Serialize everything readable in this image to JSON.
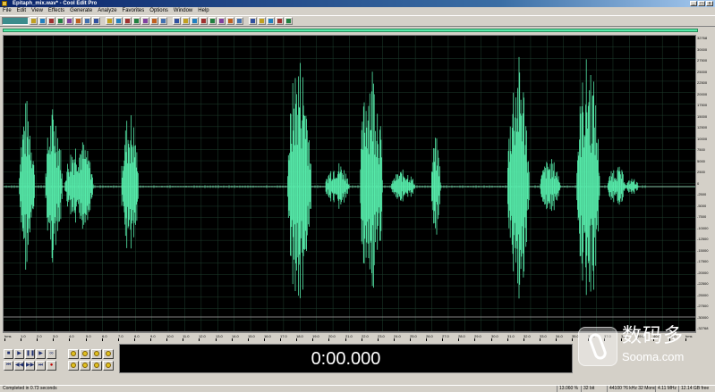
{
  "window": {
    "title": "Epitaph_mix.wav* - Cool Edit Pro",
    "buttons": [
      "_",
      "□",
      "x"
    ]
  },
  "menu": [
    "File",
    "Edit",
    "View",
    "Effects",
    "Generate",
    "Analyze",
    "Favorites",
    "Options",
    "Window",
    "Help"
  ],
  "toolbar": {
    "icons": [
      "mode-toggle-icon",
      "new-file-icon",
      "open-file-icon",
      "save-file-icon",
      "cut-icon",
      "copy-icon",
      "paste-icon",
      "undo-icon",
      "redo-icon",
      "waveform-icon",
      "spectral-icon",
      "select-tool-icon",
      "hybrid-tool-icon",
      "scrub-tool-icon",
      "zoom-tool-icon",
      "envelope-icon",
      "mix-paste-icon",
      "noise-reduction-icon",
      "normalize-icon",
      "filter-icon",
      "amplify-icon",
      "reverb-icon",
      "delay-icon",
      "pitch-icon",
      "fft-icon",
      "marker-icon",
      "loop-icon",
      "cue-list-icon",
      "analysis-icon"
    ]
  },
  "colors": {
    "waveform": "#55e8a8",
    "background": "#000000",
    "grid": "#1f3f2f",
    "centerline": "#88c8a8",
    "time_display_text": "#ffffff"
  },
  "right_ruler": {
    "ticks": [
      "32768",
      "30000",
      "27500",
      "25000",
      "22500",
      "20000",
      "17500",
      "15000",
      "12500",
      "10000",
      "7500",
      "5000",
      "2500",
      "0",
      "-2500",
      "-5000",
      "-7500",
      "-10000",
      "-12500",
      "-15000",
      "-17500",
      "-20000",
      "-22500",
      "-25000",
      "-27500",
      "-30000",
      "-32768"
    ]
  },
  "time_ruler": {
    "labels": [
      "hms",
      "1.0",
      "2.0",
      "3.0",
      "4.0",
      "5.0",
      "6.0",
      "7.0",
      "8.0",
      "9.0",
      "10.0",
      "11.0",
      "12.0",
      "13.0",
      "14.0",
      "15.0",
      "16.0",
      "17.0",
      "18.0",
      "19.0",
      "20.0",
      "21.0",
      "22.0",
      "23.0",
      "24.0",
      "25.0",
      "26.0",
      "27.0",
      "28.0",
      "29.0",
      "30.0",
      "31.0",
      "32.0",
      "33.0",
      "34.0",
      "35.0",
      "36.0",
      "37.0",
      "38.0",
      "39.0",
      "40.0",
      "41.0",
      "hms"
    ]
  },
  "waveform": {
    "clusters": [
      {
        "start": 0.022,
        "end": 0.045,
        "amp": 0.62
      },
      {
        "start": 0.06,
        "end": 0.085,
        "amp": 0.58
      },
      {
        "start": 0.088,
        "end": 0.13,
        "amp": 0.35
      },
      {
        "start": 0.17,
        "end": 0.195,
        "amp": 0.55
      },
      {
        "start": 0.41,
        "end": 0.445,
        "amp": 0.95
      },
      {
        "start": 0.465,
        "end": 0.5,
        "amp": 0.18
      },
      {
        "start": 0.515,
        "end": 0.548,
        "amp": 0.92
      },
      {
        "start": 0.56,
        "end": 0.595,
        "amp": 0.12
      },
      {
        "start": 0.618,
        "end": 0.632,
        "amp": 0.35
      },
      {
        "start": 0.728,
        "end": 0.76,
        "amp": 0.93
      },
      {
        "start": 0.775,
        "end": 0.805,
        "amp": 0.2
      },
      {
        "start": 0.828,
        "end": 0.862,
        "amp": 0.93
      },
      {
        "start": 0.873,
        "end": 0.9,
        "amp": 0.15
      },
      {
        "start": 0.9,
        "end": 0.918,
        "amp": 0.06
      }
    ]
  },
  "transport": {
    "buttons": [
      "stop-button",
      "play-button",
      "pause-button",
      "play-to-end-button",
      "loop-button",
      "go-start-button",
      "rewind-button",
      "fast-forward-button",
      "go-end-button",
      "record-button"
    ]
  },
  "zoom": {
    "buttons": [
      "zoom-in-full-button",
      "zoom-out-full-button",
      "zoom-in-button",
      "zoom-out-button",
      "zoom-selection-button",
      "zoom-left-button",
      "zoom-right-button",
      "zoom-vertical-button"
    ]
  },
  "time_display": {
    "value": "0:00.000"
  },
  "logo": {
    "name": "数码多",
    "url": "Sooma.com"
  },
  "status": {
    "left": "Completed in 0.73 seconds",
    "cells": [
      "13.060 %",
      "32 bit",
      "44100 ?6 kHz 32 Mono",
      "4.11 MHz",
      "12.14 GB free"
    ]
  }
}
